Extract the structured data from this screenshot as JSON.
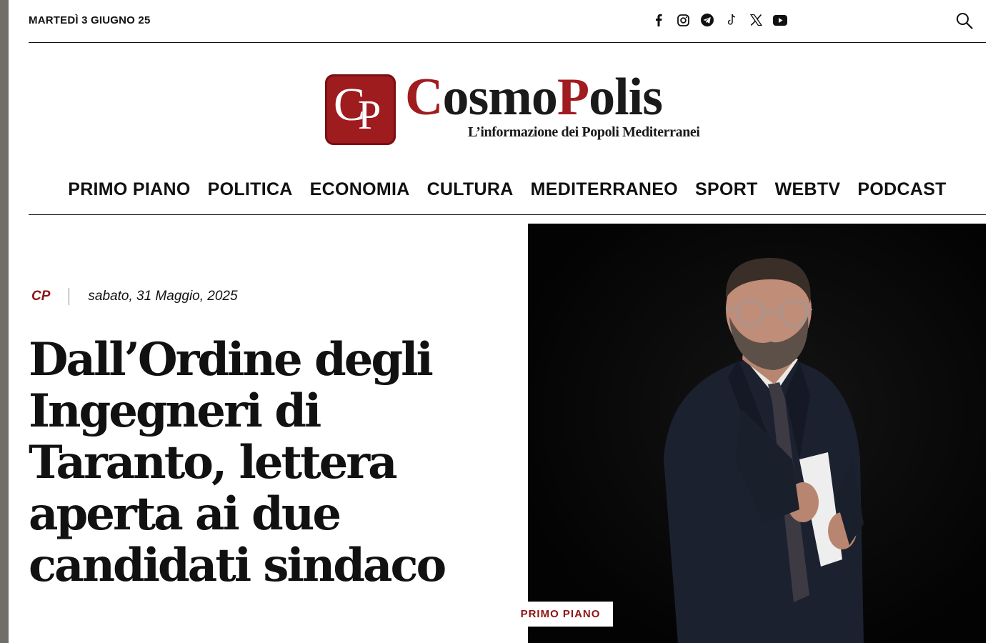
{
  "topbar": {
    "date": "MARTEDÌ 3 GIUGNO 25",
    "socials": [
      "facebook-icon",
      "instagram-icon",
      "telegram-icon",
      "tiktok-icon",
      "x-icon",
      "youtube-icon"
    ]
  },
  "logo": {
    "monogram_c": "C",
    "monogram_p": "P",
    "name_part1": "C",
    "name_part2": "osmo",
    "name_part3": "P",
    "name_part4": "olis",
    "tagline": "L’informazione dei Popoli Mediterranei"
  },
  "nav": {
    "items": [
      "PRIMO PIANO",
      "POLITICA",
      "ECONOMIA",
      "CULTURA",
      "MEDITERRANEO",
      "SPORT",
      "WEBTV",
      "PODCAST"
    ]
  },
  "article": {
    "author": "CP",
    "date": "sabato, 31 Maggio, 2025",
    "title": "Dall’Ordine degli Ingegneri di Taranto, lettera aperta ai due candidati sindaco",
    "category": "PRIMO PIANO"
  },
  "colors": {
    "brand_red": "#9e1b1e",
    "accent_red": "#8d1416",
    "text": "#111111"
  }
}
